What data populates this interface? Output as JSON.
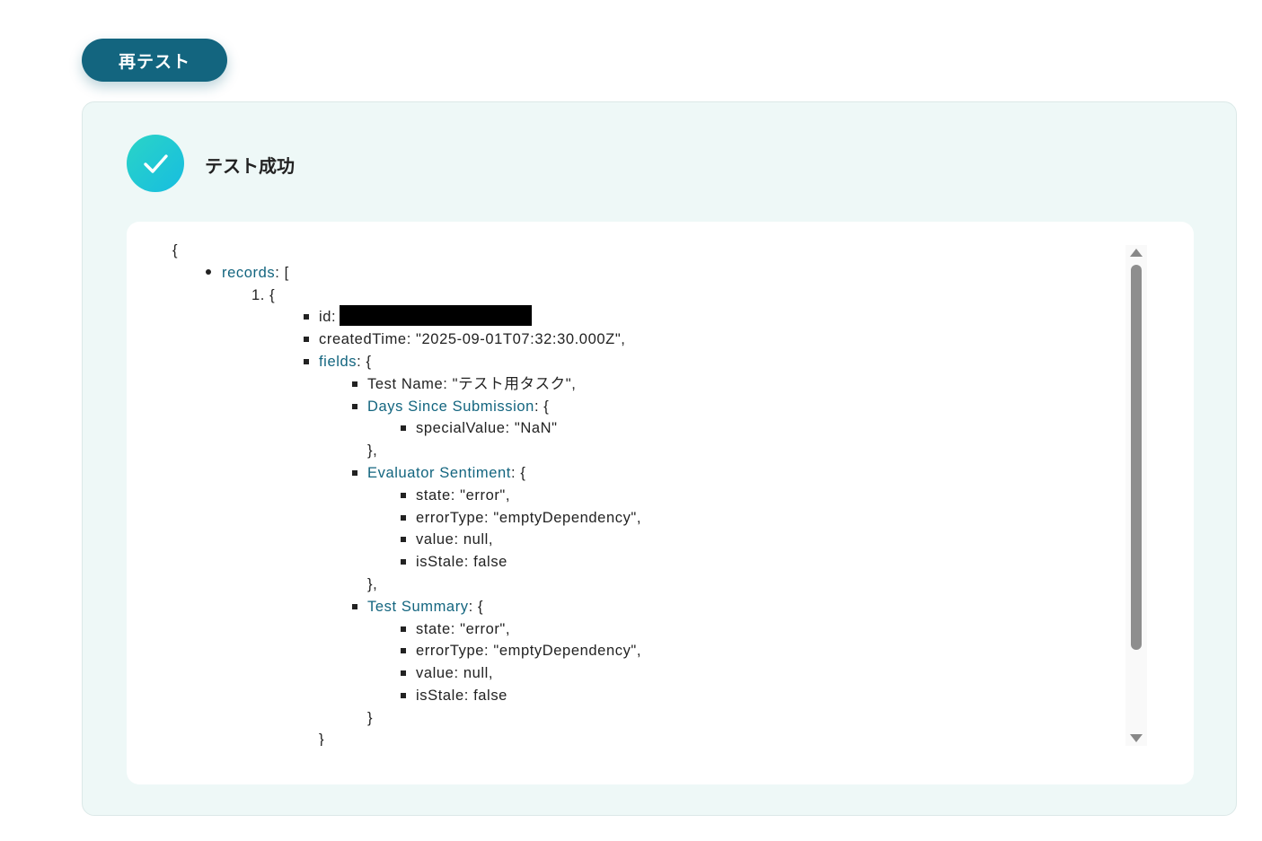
{
  "retest_button": {
    "label": "再テスト"
  },
  "result": {
    "status_icon": "check-circle-icon",
    "title": "テスト成功"
  },
  "json_lines": {
    "open_brace": "{",
    "records_key": "records",
    "records_suffix": ": [",
    "item_1": "1. {",
    "id_label": "id:",
    "created_time": "createdTime: \"2025-09-01T07:32:30.000Z\",",
    "fields_key": "fields",
    "fields_suffix": ": {",
    "test_name": "Test Name: \"テスト用タスク\",",
    "days_key": "Days Since Submission",
    "days_suffix": ": {",
    "special_value": "specialValue: \"NaN\"",
    "days_close": "},",
    "evaluator_key": "Evaluator Sentiment",
    "evaluator_suffix": ": {",
    "evaluator_state": "state: \"error\",",
    "evaluator_error_type": "errorType: \"emptyDependency\",",
    "evaluator_value": "value: null,",
    "evaluator_is_stale": "isStale: false",
    "evaluator_close": "},",
    "summary_key": "Test Summary",
    "summary_suffix": ": {",
    "summary_state": "state: \"error\",",
    "summary_error_type": "errorType: \"emptyDependency\",",
    "summary_value": "value: null,",
    "summary_is_stale": "isStale: false",
    "summary_close": "}",
    "item_close_partial": "}"
  },
  "colors": {
    "button_bg": "#13657f",
    "key_link": "#13657f",
    "panel_bg": "#eef8f7",
    "success_gradient_start": "#2ad4c7",
    "success_gradient_end": "#17bde0"
  },
  "icons": {
    "scroll_up": "triangle-up-icon",
    "scroll_down": "triangle-down-icon",
    "redaction": "redaction-bar"
  }
}
